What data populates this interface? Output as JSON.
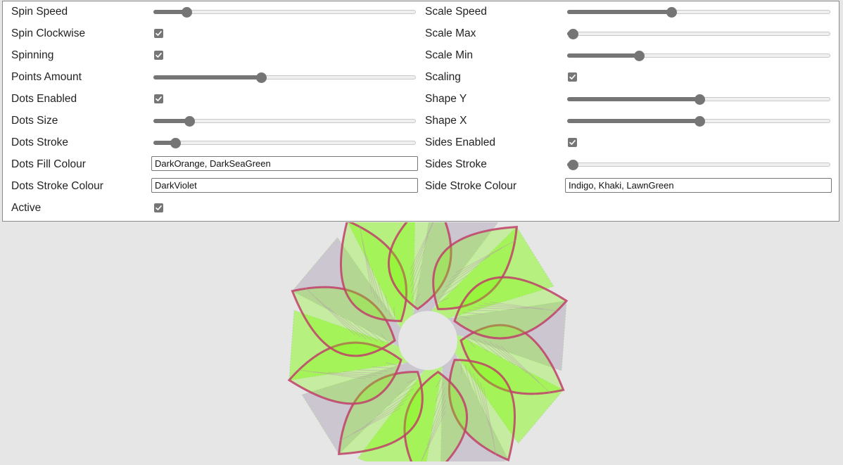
{
  "left": [
    {
      "key": "spin_speed",
      "label": "Spin Speed",
      "type": "slider",
      "value": 0.11
    },
    {
      "key": "spin_clockwise",
      "label": "Spin Clockwise",
      "type": "checkbox",
      "checked": true
    },
    {
      "key": "spinning",
      "label": "Spinning",
      "type": "checkbox",
      "checked": true
    },
    {
      "key": "points_amount",
      "label": "Points Amount",
      "type": "slider",
      "value": 0.405
    },
    {
      "key": "dots_enabled",
      "label": "Dots Enabled",
      "type": "checkbox",
      "checked": true
    },
    {
      "key": "dots_size",
      "label": "Dots Size",
      "type": "slider",
      "value": 0.12
    },
    {
      "key": "dots_stroke",
      "label": "Dots Stroke",
      "type": "slider",
      "value": 0.065
    },
    {
      "key": "dots_fill_colour",
      "label": "Dots Fill Colour",
      "type": "text",
      "value": "DarkOrange, DarkSeaGreen"
    },
    {
      "key": "dots_stroke_colour",
      "label": "Dots Stroke Colour",
      "type": "text",
      "value": "DarkViolet"
    },
    {
      "key": "active",
      "label": "Active",
      "type": "checkbox",
      "checked": true
    }
  ],
  "right": [
    {
      "key": "scale_speed",
      "label": "Scale Speed",
      "type": "slider",
      "value": 0.39
    },
    {
      "key": "scale_max",
      "label": "Scale Max",
      "type": "slider",
      "value": 0.0
    },
    {
      "key": "scale_min",
      "label": "Scale Min",
      "type": "slider",
      "value": 0.26
    },
    {
      "key": "scaling",
      "label": "Scaling",
      "type": "checkbox",
      "checked": true
    },
    {
      "key": "shape_y",
      "label": "Shape Y",
      "type": "slider",
      "value": 0.5
    },
    {
      "key": "shape_x",
      "label": "Shape X",
      "type": "slider",
      "value": 0.5
    },
    {
      "key": "sides_enabled",
      "label": "Sides Enabled",
      "type": "checkbox",
      "checked": true
    },
    {
      "key": "sides_stroke",
      "label": "Sides Stroke",
      "type": "slider",
      "value": 0.0
    },
    {
      "key": "side_stroke_colour",
      "label": "Side Stroke Colour",
      "type": "text",
      "value": "Indigo, Khaki, LawnGreen"
    }
  ],
  "colors": {
    "petal_fill": "#7cfc00",
    "petal_edge": "#c0406a",
    "shadow": "#9a8aa8",
    "bg": "#e6e6e6"
  }
}
